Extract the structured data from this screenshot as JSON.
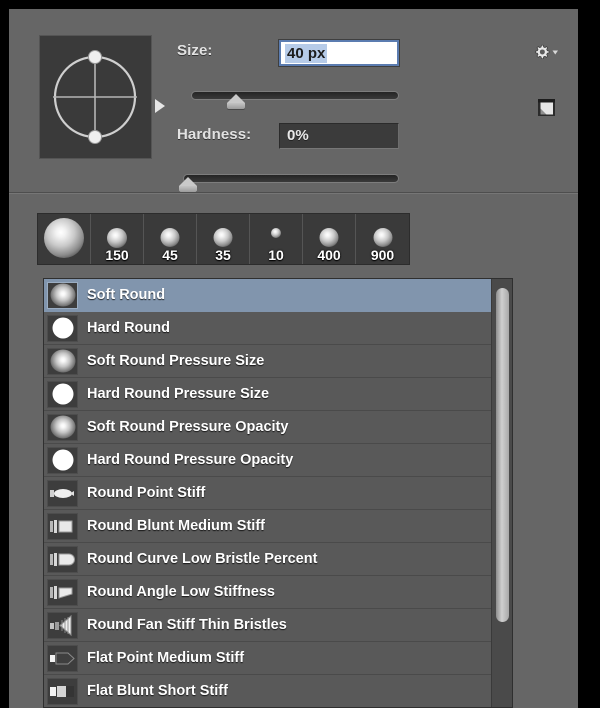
{
  "panel": {
    "name": "Brush Preset Picker",
    "background_color": "#666666",
    "frame_color": "#000000"
  },
  "controls": {
    "size_label": "Size:",
    "size_value": "40 px",
    "size_placeholder": "40 px",
    "size_slider_percent": 22,
    "hardness_label": "Hardness:",
    "hardness_value": "0%",
    "hardness_slider_percent": 0
  },
  "icons": {
    "gear": "gear-icon",
    "gear_dropdown": "chevron-down-icon",
    "new_preset": "new-preset-icon",
    "tip_preview": "brush-tip-angle-preview"
  },
  "preset_strip": {
    "items": [
      {
        "label": "",
        "dot_size": 40,
        "soft": true,
        "selected": true
      },
      {
        "label": "150",
        "dot_size": 20,
        "soft": true,
        "selected": false
      },
      {
        "label": "45",
        "dot_size": 19,
        "soft": true,
        "selected": false
      },
      {
        "label": "35",
        "dot_size": 19,
        "soft": true,
        "selected": false
      },
      {
        "label": "10",
        "dot_size": 10,
        "soft": true,
        "selected": false
      },
      {
        "label": "400",
        "dot_size": 19,
        "soft": true,
        "selected": false
      },
      {
        "label": "900",
        "dot_size": 19,
        "soft": true,
        "selected": false
      }
    ]
  },
  "brush_list": {
    "selected_index": 0,
    "selection_color": "#8195ad",
    "items": [
      {
        "name": "Soft Round",
        "thumb": "soft-round"
      },
      {
        "name": "Hard Round",
        "thumb": "hard-round"
      },
      {
        "name": "Soft Round Pressure Size",
        "thumb": "soft-round"
      },
      {
        "name": "Hard Round Pressure Size",
        "thumb": "hard-round"
      },
      {
        "name": "Soft Round Pressure Opacity",
        "thumb": "soft-round"
      },
      {
        "name": "Hard Round Pressure Opacity",
        "thumb": "hard-round"
      },
      {
        "name": "Round Point Stiff",
        "thumb": "bristle-round-point"
      },
      {
        "name": "Round Blunt Medium Stiff",
        "thumb": "bristle-round-blunt"
      },
      {
        "name": "Round Curve Low Bristle Percent",
        "thumb": "bristle-round-curve"
      },
      {
        "name": "Round Angle Low Stiffness",
        "thumb": "bristle-round-angle"
      },
      {
        "name": "Round Fan Stiff Thin Bristles",
        "thumb": "bristle-round-fan"
      },
      {
        "name": "Flat Point Medium Stiff",
        "thumb": "bristle-flat-point"
      },
      {
        "name": "Flat Blunt Short Stiff",
        "thumb": "bristle-flat-blunt"
      }
    ]
  },
  "scrollbar": {
    "thumb_top_percent": 2,
    "thumb_height_percent": 78
  }
}
